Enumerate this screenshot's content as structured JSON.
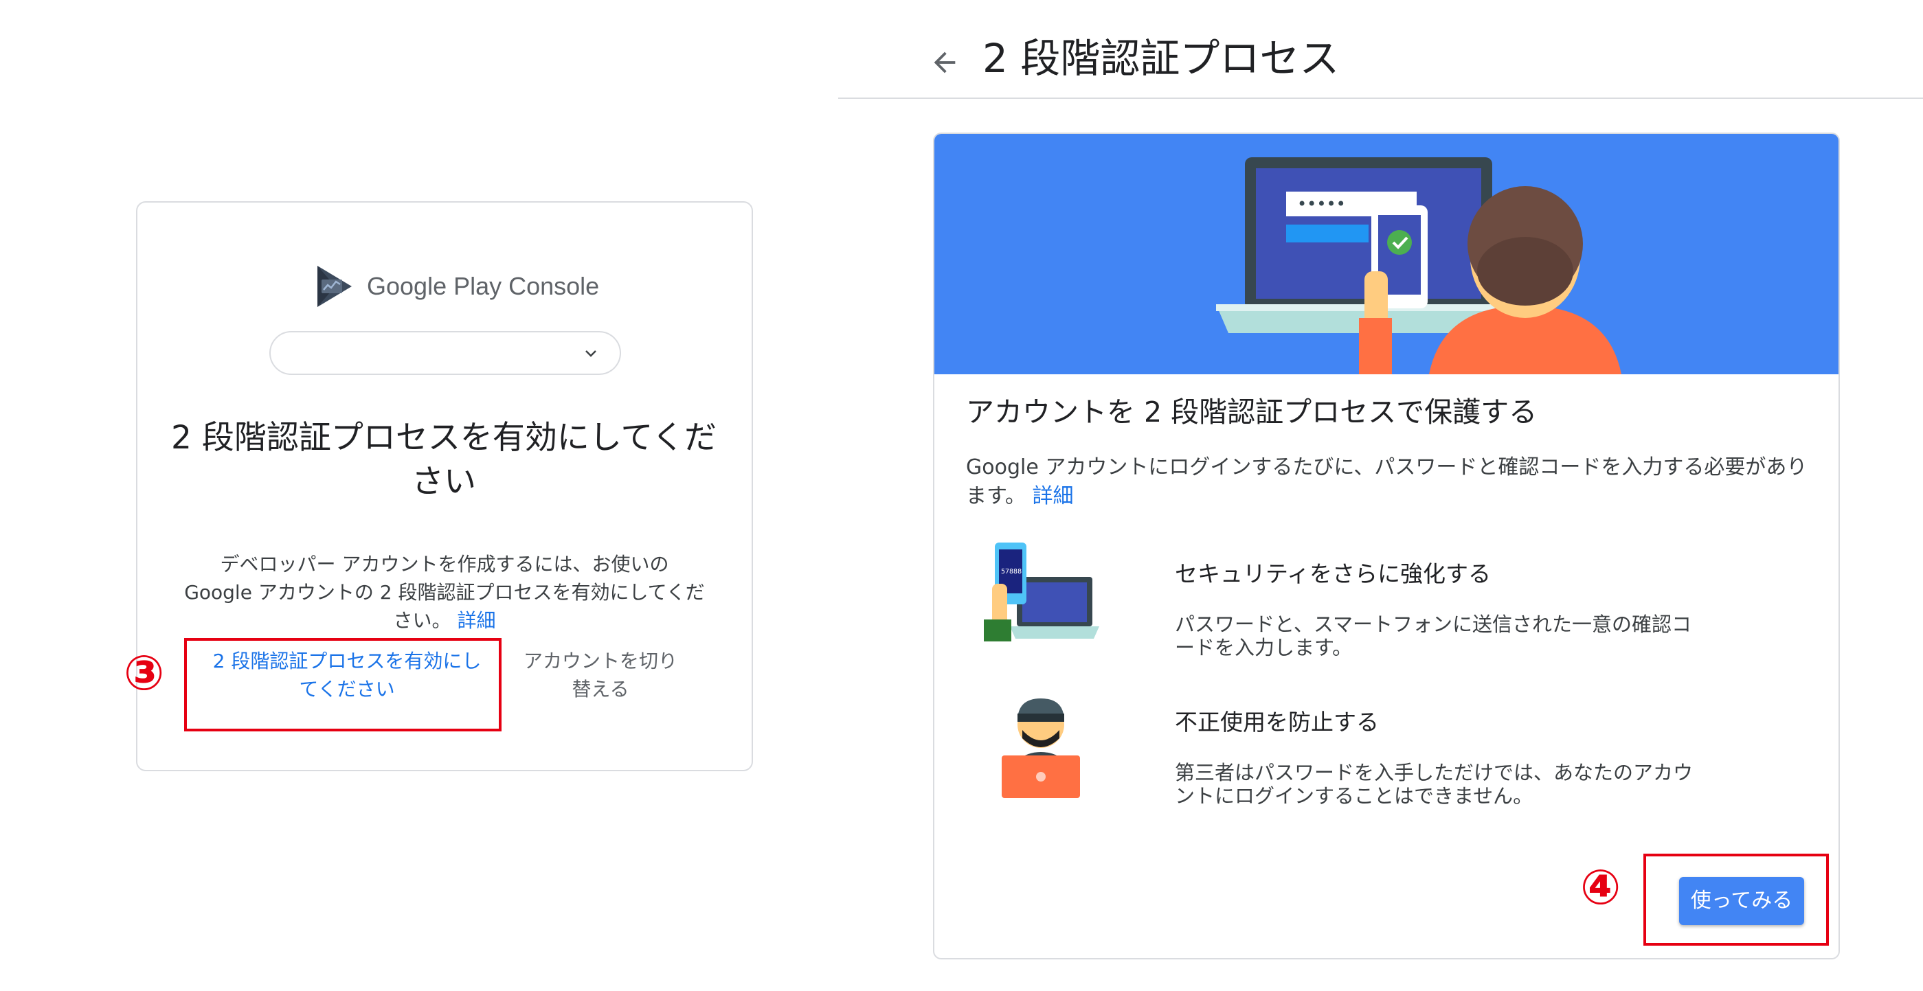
{
  "left": {
    "logo_text": "Google Play Console",
    "title": "2 段階認証プロセスを有効にしてください",
    "desc": "デベロッパー アカウントを作成するには、お使いの Google アカウントの 2 段階認証プロセスを有効にしてください。",
    "desc_link": "詳細",
    "enable_button": "2 段階認証プロセスを有効にしてください",
    "switch_button": "アカウントを切り替える",
    "select_value": ""
  },
  "right": {
    "header_title": "2 段階認証プロセス",
    "card_title": "アカウントを 2 段階認証プロセスで保護する",
    "desc": "Google アカウントにログインするたびに、パスワードと確認コードを入力する必要があります。",
    "desc_link": "詳細",
    "features": [
      {
        "title": "セキュリティをさらに強化する",
        "desc": "パスワードと、スマートフォンに送信された一意の確認コードを入力します。",
        "icon": "phone-laptop-illustration"
      },
      {
        "title": "不正使用を防止する",
        "desc": "第三者はパスワードを入手しただけでは、あなたのアカウントにログインすることはできません。",
        "icon": "hacker-illustration"
      }
    ],
    "try_button": "使ってみる"
  },
  "annotations": {
    "marker_3": "③",
    "marker_4": "④"
  },
  "colors": {
    "accent": "#4285f4",
    "link": "#1a73e8",
    "annotation_red": "#e60012",
    "banner": "#4285f4"
  }
}
